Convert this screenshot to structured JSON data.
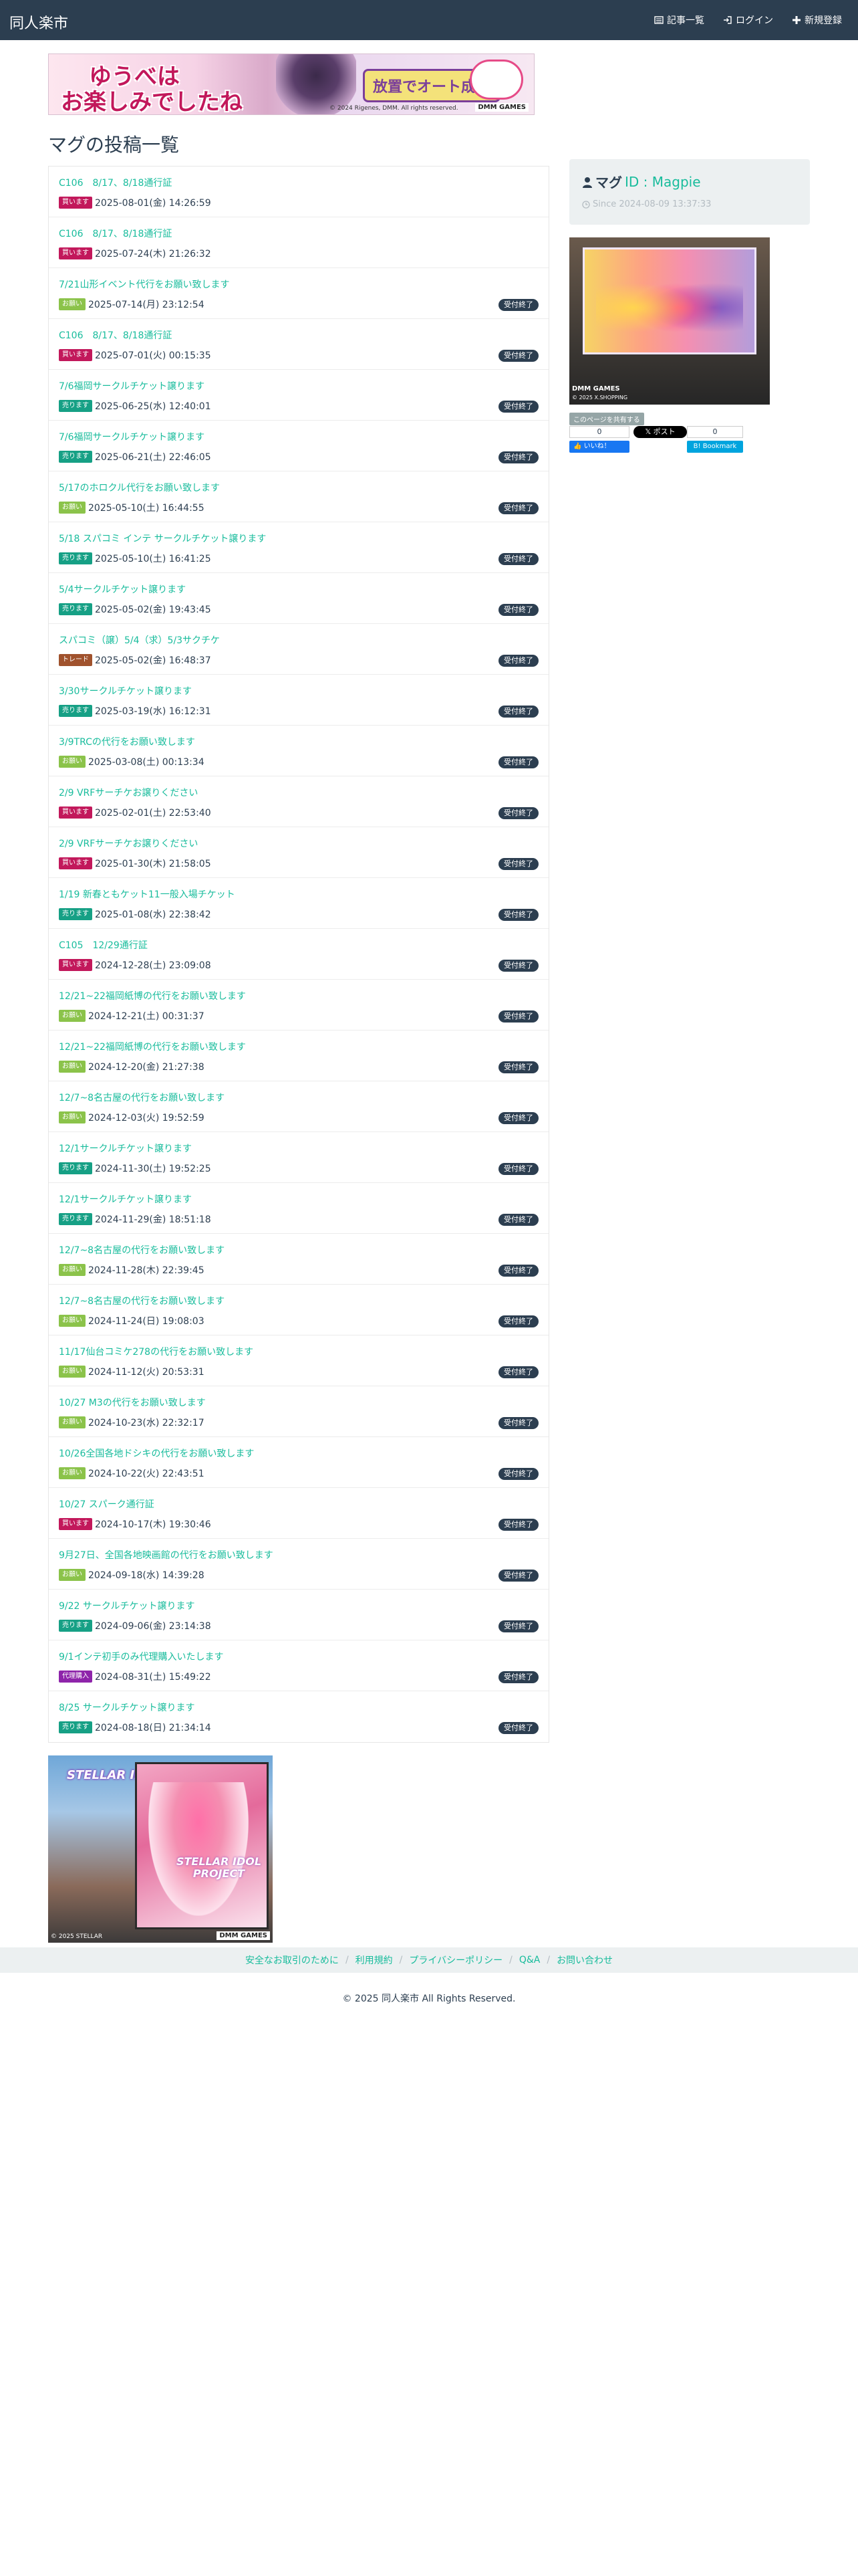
{
  "navbar": {
    "brand": "同人楽市",
    "links": [
      {
        "label": "記事一覧",
        "icon": "list-icon"
      },
      {
        "label": "ログイン",
        "icon": "login-icon"
      },
      {
        "label": "新規登録",
        "icon": "plus-icon"
      }
    ]
  },
  "top_banner": {
    "line1": "ゆうべは",
    "line2": "お楽しみでしたね",
    "pill": "放置でオート成長",
    "logo": "",
    "copy": "© 2024 Rigenes, DMM. All rights reserved.",
    "dmm": "DMM GAMES"
  },
  "page_title": "マグの投稿一覧",
  "posts": [
    {
      "title": "C106　8/17、8/18通行証",
      "category": "買います",
      "cat_class": "cat-buy",
      "date": "2025-08-01(金) 14:26:59",
      "status": ""
    },
    {
      "title": "C106　8/17、8/18通行証",
      "category": "買います",
      "cat_class": "cat-buy",
      "date": "2025-07-24(木) 21:26:32",
      "status": ""
    },
    {
      "title": "7/21山形イベント代行をお願い致します",
      "category": "お願い",
      "cat_class": "cat-ask",
      "date": "2025-07-14(月) 23:12:54",
      "status": "受付終了"
    },
    {
      "title": "C106　8/17、8/18通行証",
      "category": "買います",
      "cat_class": "cat-buy",
      "date": "2025-07-01(火) 00:15:35",
      "status": "受付終了"
    },
    {
      "title": "7/6福岡サークルチケット譲ります",
      "category": "売ります",
      "cat_class": "cat-sell",
      "date": "2025-06-25(水) 12:40:01",
      "status": "受付終了"
    },
    {
      "title": "7/6福岡サークルチケット譲ります",
      "category": "売ります",
      "cat_class": "cat-sell",
      "date": "2025-06-21(土) 22:46:05",
      "status": "受付終了"
    },
    {
      "title": "5/17のホロクル代行をお願い致します",
      "category": "お願い",
      "cat_class": "cat-ask",
      "date": "2025-05-10(土) 16:44:55",
      "status": "受付終了"
    },
    {
      "title": "5/18 スパコミ インテ サークルチケット譲ります",
      "category": "売ります",
      "cat_class": "cat-sell",
      "date": "2025-05-10(土) 16:41:25",
      "status": "受付終了"
    },
    {
      "title": "5/4サークルチケット譲ります",
      "category": "売ります",
      "cat_class": "cat-sell",
      "date": "2025-05-02(金) 19:43:45",
      "status": "受付終了"
    },
    {
      "title": "スパコミ（譲）5/4（求）5/3サクチケ",
      "category": "トレード",
      "cat_class": "cat-trade",
      "date": "2025-05-02(金) 16:48:37",
      "status": "受付終了"
    },
    {
      "title": "3/30サークルチケット譲ります",
      "category": "売ります",
      "cat_class": "cat-sell",
      "date": "2025-03-19(水) 16:12:31",
      "status": "受付終了"
    },
    {
      "title": "3/9TRCの代行をお願い致します",
      "category": "お願い",
      "cat_class": "cat-ask",
      "date": "2025-03-08(土) 00:13:34",
      "status": "受付終了"
    },
    {
      "title": "2/9 VRFサーチケお譲りください",
      "category": "買います",
      "cat_class": "cat-buy",
      "date": "2025-02-01(土) 22:53:40",
      "status": "受付終了"
    },
    {
      "title": "2/9 VRFサーチケお譲りください",
      "category": "買います",
      "cat_class": "cat-buy",
      "date": "2025-01-30(木) 21:58:05",
      "status": "受付終了"
    },
    {
      "title": "1/19 新春ともケット11一般入場チケット",
      "category": "売ります",
      "cat_class": "cat-sell",
      "date": "2025-01-08(水) 22:38:42",
      "status": "受付終了"
    },
    {
      "title": "C105　12/29通行証",
      "category": "買います",
      "cat_class": "cat-buy",
      "date": "2024-12-28(土) 23:09:08",
      "status": "受付終了"
    },
    {
      "title": "12/21~22福岡紙博の代行をお願い致します",
      "category": "お願い",
      "cat_class": "cat-ask",
      "date": "2024-12-21(土) 00:31:37",
      "status": "受付終了"
    },
    {
      "title": "12/21~22福岡紙博の代行をお願い致します",
      "category": "お願い",
      "cat_class": "cat-ask",
      "date": "2024-12-20(金) 21:27:38",
      "status": "受付終了"
    },
    {
      "title": "12/7~8名古屋の代行をお願い致します",
      "category": "お願い",
      "cat_class": "cat-ask",
      "date": "2024-12-03(火) 19:52:59",
      "status": "受付終了"
    },
    {
      "title": "12/1サークルチケット譲ります",
      "category": "売ります",
      "cat_class": "cat-sell",
      "date": "2024-11-30(土) 19:52:25",
      "status": "受付終了"
    },
    {
      "title": "12/1サークルチケット譲ります",
      "category": "売ります",
      "cat_class": "cat-sell",
      "date": "2024-11-29(金) 18:51:18",
      "status": "受付終了"
    },
    {
      "title": "12/7~8名古屋の代行をお願い致します",
      "category": "お願い",
      "cat_class": "cat-ask",
      "date": "2024-11-28(木) 22:39:45",
      "status": "受付終了"
    },
    {
      "title": "12/7~8名古屋の代行をお願い致します",
      "category": "お願い",
      "cat_class": "cat-ask",
      "date": "2024-11-24(日) 19:08:03",
      "status": "受付終了"
    },
    {
      "title": "11/17仙台コミケ278の代行をお願い致します",
      "category": "お願い",
      "cat_class": "cat-ask",
      "date": "2024-11-12(火) 20:53:31",
      "status": "受付終了"
    },
    {
      "title": "10/27 M3の代行をお願い致します",
      "category": "お願い",
      "cat_class": "cat-ask",
      "date": "2024-10-23(水) 22:32:17",
      "status": "受付終了"
    },
    {
      "title": "10/26全国各地ドシキの代行をお願い致します",
      "category": "お願い",
      "cat_class": "cat-ask",
      "date": "2024-10-22(火) 22:43:51",
      "status": "受付終了"
    },
    {
      "title": "10/27 スパーク通行証",
      "category": "買います",
      "cat_class": "cat-buy",
      "date": "2024-10-17(木) 19:30:46",
      "status": "受付終了"
    },
    {
      "title": "9月27日、全国各地映画館の代行をお願い致します",
      "category": "お願い",
      "cat_class": "cat-ask",
      "date": "2024-09-18(水) 14:39:28",
      "status": "受付終了"
    },
    {
      "title": "9/22 サークルチケット譲ります",
      "category": "売ります",
      "cat_class": "cat-sell",
      "date": "2024-09-06(金) 23:14:38",
      "status": "受付終了"
    },
    {
      "title": "9/1インテ初手のみ代理購入いたします",
      "category": "代理購入",
      "cat_class": "cat-proxy",
      "date": "2024-08-31(土) 15:49:22",
      "status": "受付終了"
    },
    {
      "title": "8/25 サークルチケット譲ります",
      "category": "売ります",
      "cat_class": "cat-sell",
      "date": "2024-08-18(日) 21:34:14",
      "status": "受付終了"
    }
  ],
  "profile": {
    "name": "マグ",
    "id_label": "ID : Magpie",
    "since": "Since 2024-08-09 13:37:33"
  },
  "side_banner": {
    "text": "",
    "dmm": "DMM GAMES",
    "copy": "© 2025 X.SHOPPING"
  },
  "share": {
    "label": "このページを共有する",
    "fb_count": "0",
    "fb_label": "いいね！",
    "x_label": "ポスト",
    "hb_count": "0",
    "hb_label": "Bookmark"
  },
  "bottom_banner": {
    "left_text": "STELLAR IDOL PROJECT",
    "right_text": "STELLAR IDOL PROJECT",
    "dmm": "DMM GAMES",
    "copy": "© 2025 STELLAR"
  },
  "footer": {
    "links": [
      "安全なお取引のために",
      "利用規約",
      "プライバシーポリシー",
      "Q&A",
      "お問い合わせ"
    ],
    "copyright": "© 2025 同人楽市 All Rights Reserved."
  }
}
